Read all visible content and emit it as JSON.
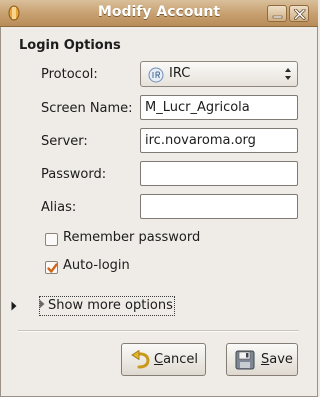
{
  "window": {
    "title": "Modify Account",
    "title_bar_color": "#c79f6f",
    "controls": [
      "minimize-icon",
      "close-icon"
    ]
  },
  "login_options": {
    "section_title": "Login Options",
    "protocol": {
      "label": "Protocol:",
      "value": "IRC",
      "icon": "irc-protocol-icon"
    },
    "screen_name": {
      "label": "Screen Name:",
      "value": "M_Lucr_Agricola"
    },
    "server": {
      "label": "Server:",
      "value": "irc.novaroma.org"
    },
    "password": {
      "label": "Password:",
      "value": ""
    },
    "alias": {
      "label": "Alias:",
      "value": ""
    },
    "remember_password": {
      "label": "Remember password",
      "checked": false
    },
    "auto_login": {
      "label": "Auto-login",
      "checked": true
    }
  },
  "expander": {
    "label": "Show more options",
    "expanded": false
  },
  "buttons": {
    "cancel": {
      "label_underlined": "C",
      "label_rest": "ancel",
      "icon": "undo-icon"
    },
    "save": {
      "label_underlined": "S",
      "label_rest": "ave",
      "icon": "floppy-disk-icon"
    }
  },
  "colors": {
    "check_accent": "#d1661a",
    "background": "#efebe7"
  }
}
